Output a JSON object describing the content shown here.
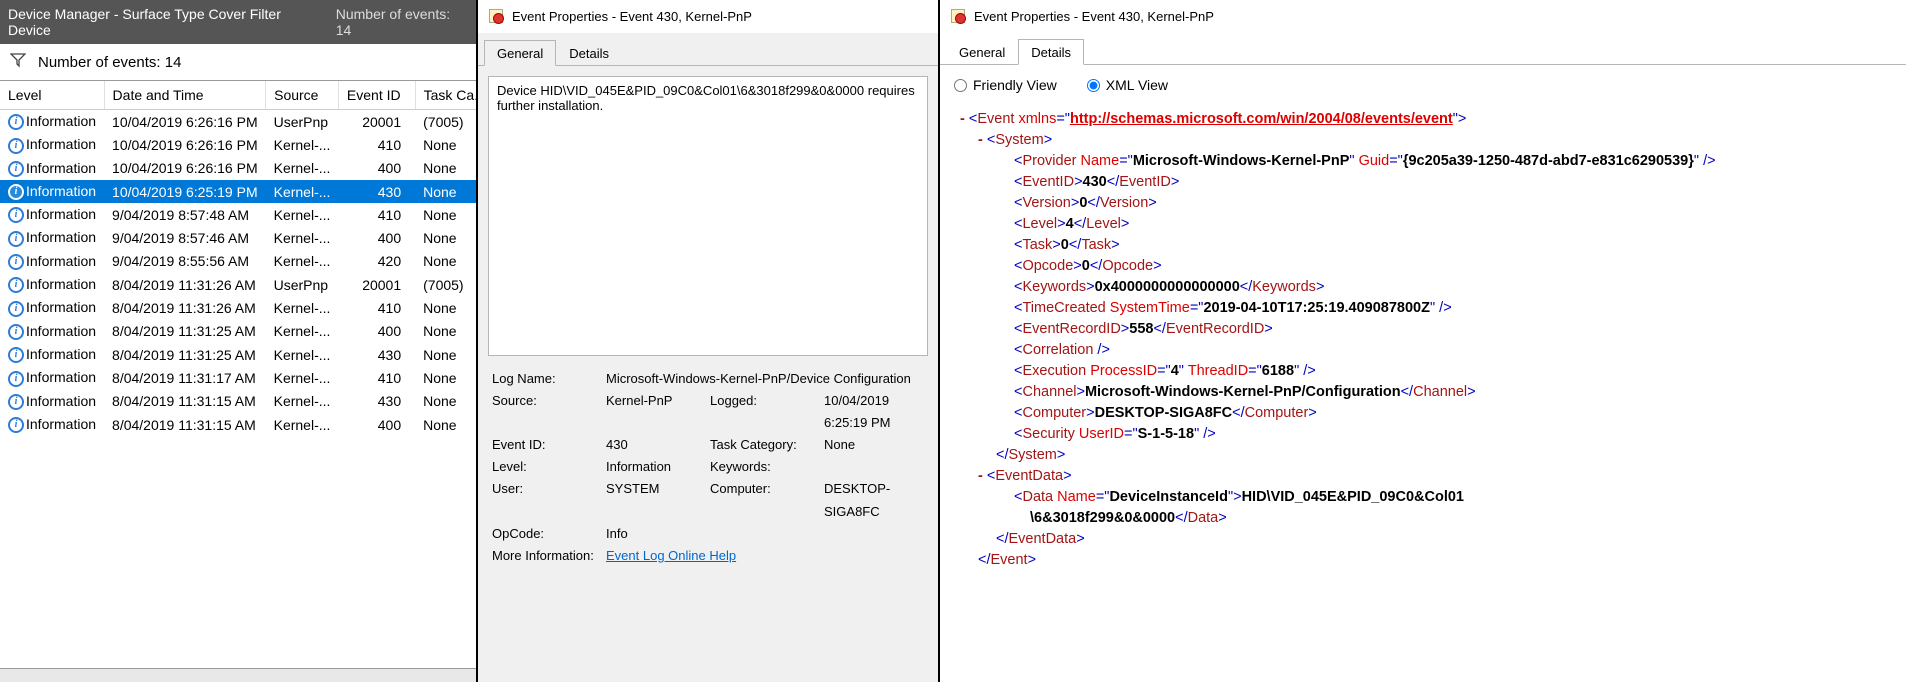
{
  "panel1": {
    "title": "Device Manager - Surface Type Cover Filter Device",
    "title_count": "Number of events: 14",
    "filter_text": "Number of events: 14",
    "columns": {
      "level": "Level",
      "dt": "Date and Time",
      "src": "Source",
      "eid": "Event ID",
      "tc": "Task Ca..."
    },
    "rows": [
      {
        "level": "Information",
        "dt": "10/04/2019 6:26:16 PM",
        "src": "UserPnp",
        "eid": "20001",
        "tc": "(7005)",
        "selected": false
      },
      {
        "level": "Information",
        "dt": "10/04/2019 6:26:16 PM",
        "src": "Kernel-...",
        "eid": "410",
        "tc": "None",
        "selected": false
      },
      {
        "level": "Information",
        "dt": "10/04/2019 6:26:16 PM",
        "src": "Kernel-...",
        "eid": "400",
        "tc": "None",
        "selected": false
      },
      {
        "level": "Information",
        "dt": "10/04/2019 6:25:19 PM",
        "src": "Kernel-...",
        "eid": "430",
        "tc": "None",
        "selected": true
      },
      {
        "level": "Information",
        "dt": "9/04/2019 8:57:48 AM",
        "src": "Kernel-...",
        "eid": "410",
        "tc": "None",
        "selected": false
      },
      {
        "level": "Information",
        "dt": "9/04/2019 8:57:46 AM",
        "src": "Kernel-...",
        "eid": "400",
        "tc": "None",
        "selected": false
      },
      {
        "level": "Information",
        "dt": "9/04/2019 8:55:56 AM",
        "src": "Kernel-...",
        "eid": "420",
        "tc": "None",
        "selected": false
      },
      {
        "level": "Information",
        "dt": "8/04/2019 11:31:26 AM",
        "src": "UserPnp",
        "eid": "20001",
        "tc": "(7005)",
        "selected": false
      },
      {
        "level": "Information",
        "dt": "8/04/2019 11:31:26 AM",
        "src": "Kernel-...",
        "eid": "410",
        "tc": "None",
        "selected": false
      },
      {
        "level": "Information",
        "dt": "8/04/2019 11:31:25 AM",
        "src": "Kernel-...",
        "eid": "400",
        "tc": "None",
        "selected": false
      },
      {
        "level": "Information",
        "dt": "8/04/2019 11:31:25 AM",
        "src": "Kernel-...",
        "eid": "430",
        "tc": "None",
        "selected": false
      },
      {
        "level": "Information",
        "dt": "8/04/2019 11:31:17 AM",
        "src": "Kernel-...",
        "eid": "410",
        "tc": "None",
        "selected": false
      },
      {
        "level": "Information",
        "dt": "8/04/2019 11:31:15 AM",
        "src": "Kernel-...",
        "eid": "430",
        "tc": "None",
        "selected": false
      },
      {
        "level": "Information",
        "dt": "8/04/2019 11:31:15 AM",
        "src": "Kernel-...",
        "eid": "400",
        "tc": "None",
        "selected": false
      }
    ]
  },
  "panel2": {
    "title": "Event Properties - Event 430, Kernel-PnP",
    "tabs": {
      "general": "General",
      "details": "Details"
    },
    "description": "Device HID\\VID_045E&PID_09C0&Col01\\6&3018f299&0&0000 requires further installation.",
    "props": {
      "logname_lbl": "Log Name:",
      "logname": "Microsoft-Windows-Kernel-PnP/Device Configuration",
      "source_lbl": "Source:",
      "source": "Kernel-PnP",
      "logged_lbl": "Logged:",
      "logged": "10/04/2019 6:25:19 PM",
      "eventid_lbl": "Event ID:",
      "eventid": "430",
      "taskcat_lbl": "Task Category:",
      "taskcat": "None",
      "level_lbl": "Level:",
      "level": "Information",
      "keywords_lbl": "Keywords:",
      "keywords": "",
      "user_lbl": "User:",
      "user": "SYSTEM",
      "computer_lbl": "Computer:",
      "computer": "DESKTOP-SIGA8FC",
      "opcode_lbl": "OpCode:",
      "opcode": "Info",
      "moreinfo_lbl": "More Information:",
      "moreinfo_link": "Event Log Online Help"
    }
  },
  "panel3": {
    "title": "Event Properties - Event 430, Kernel-PnP",
    "tabs": {
      "general": "General",
      "details": "Details"
    },
    "radios": {
      "friendly": "Friendly View",
      "xml": "XML View"
    },
    "xml": {
      "xmlns": "http://schemas.microsoft.com/win/2004/08/events/event",
      "provider_name": "Microsoft-Windows-Kernel-PnP",
      "provider_guid": "{9c205a39-1250-487d-abd7-e831c6290539}",
      "event_id": "430",
      "version": "0",
      "level": "4",
      "task": "0",
      "opcode": "0",
      "keywords": "0x4000000000000000",
      "time_created": "2019-04-10T17:25:19.409087800Z",
      "event_record_id": "558",
      "exec_pid": "4",
      "exec_tid": "6188",
      "channel": "Microsoft-Windows-Kernel-PnP/Configuration",
      "computer": "DESKTOP-SIGA8FC",
      "security_userid": "S-1-5-18",
      "data_name": "DeviceInstanceId",
      "data_line1": "HID\\VID_045E&PID_09C0&Col01",
      "data_line2": "\\6&3018f299&0&0000"
    }
  }
}
